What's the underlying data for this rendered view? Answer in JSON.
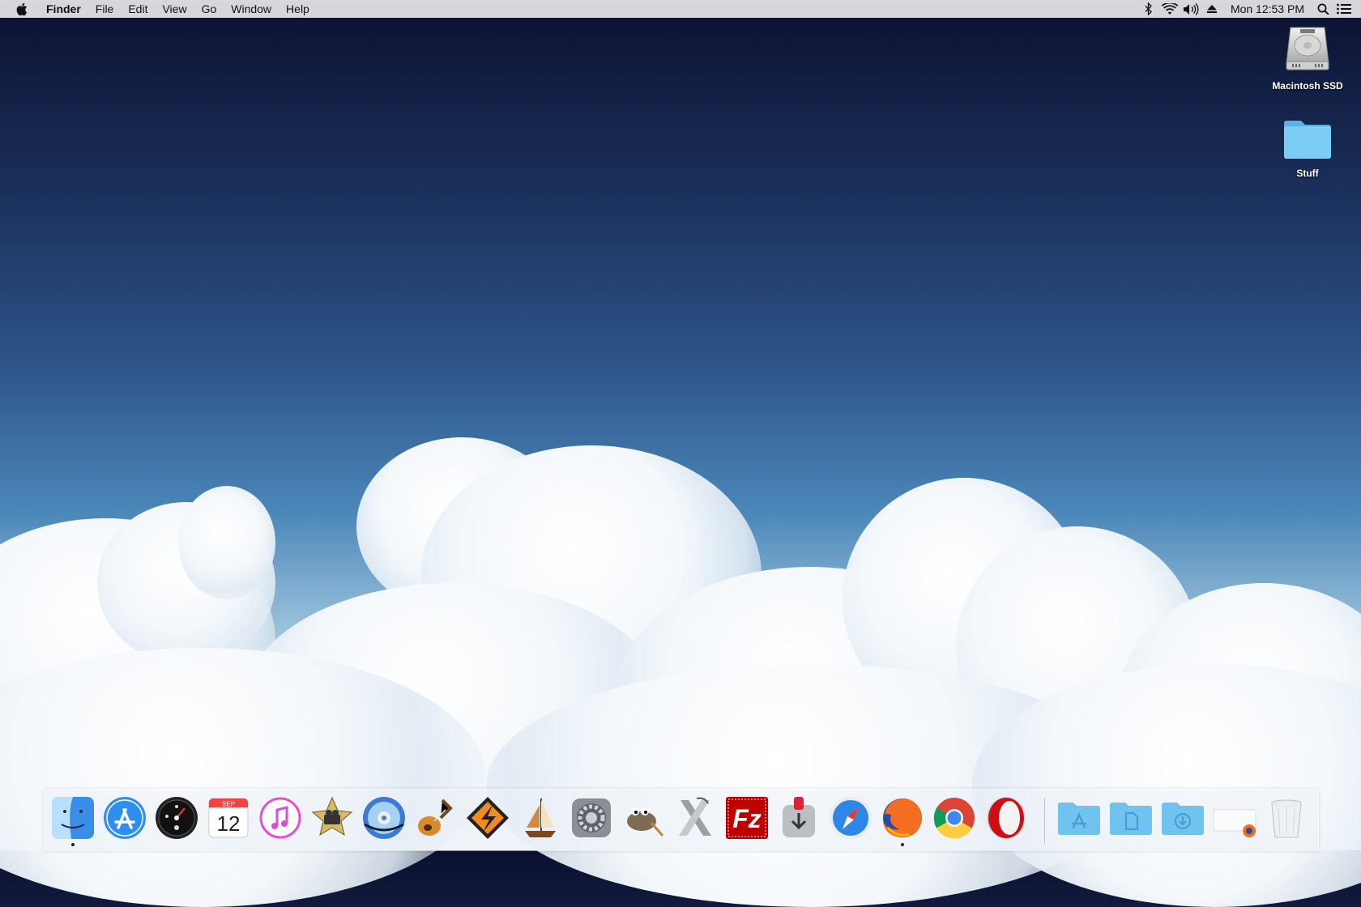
{
  "menubar": {
    "app_name": "Finder",
    "menus": [
      "File",
      "Edit",
      "View",
      "Go",
      "Window",
      "Help"
    ],
    "status_icons": [
      "bluetooth-icon",
      "wifi-icon",
      "volume-icon",
      "eject-icon"
    ],
    "clock": "Mon 12:53 PM",
    "right_icons": [
      "spotlight-icon",
      "notification-center-icon"
    ]
  },
  "desktop": {
    "icons": [
      {
        "label": "Macintosh SSD",
        "icon": "hard-drive-icon"
      },
      {
        "label": "Stuff",
        "icon": "folder-icon"
      }
    ]
  },
  "dock": {
    "apps": [
      {
        "name": "finder-icon",
        "running": true
      },
      {
        "name": "app-store-icon",
        "running": false
      },
      {
        "name": "dashboard-icon",
        "running": false
      },
      {
        "name": "calendar-icon",
        "running": false,
        "month": "SEP",
        "day": "12"
      },
      {
        "name": "itunes-icon",
        "running": false
      },
      {
        "name": "imovie-icon",
        "running": false
      },
      {
        "name": "dvd-player-icon",
        "running": false
      },
      {
        "name": "garageband-icon",
        "running": false
      },
      {
        "name": "winamp-icon",
        "running": false
      },
      {
        "name": "sailboat-app-icon",
        "running": false
      },
      {
        "name": "system-preferences-icon",
        "running": false
      },
      {
        "name": "gimp-icon",
        "running": false
      },
      {
        "name": "x11-icon",
        "running": false
      },
      {
        "name": "filezilla-icon",
        "running": false
      },
      {
        "name": "transmission-icon",
        "running": false
      },
      {
        "name": "safari-icon",
        "running": false
      },
      {
        "name": "firefox-icon",
        "running": true
      },
      {
        "name": "chrome-icon",
        "running": false
      },
      {
        "name": "opera-icon",
        "running": false
      }
    ],
    "stacks": [
      {
        "name": "applications-folder-icon"
      },
      {
        "name": "documents-folder-icon"
      },
      {
        "name": "downloads-folder-icon"
      },
      {
        "name": "firefox-minimized-window-icon"
      },
      {
        "name": "trash-icon"
      }
    ]
  },
  "colors": {
    "sky_top": "#0b1130",
    "sky_mid": "#2c5286",
    "menubar_bg": "#e8e8eb",
    "folder_blue": "#6ec3ef"
  }
}
